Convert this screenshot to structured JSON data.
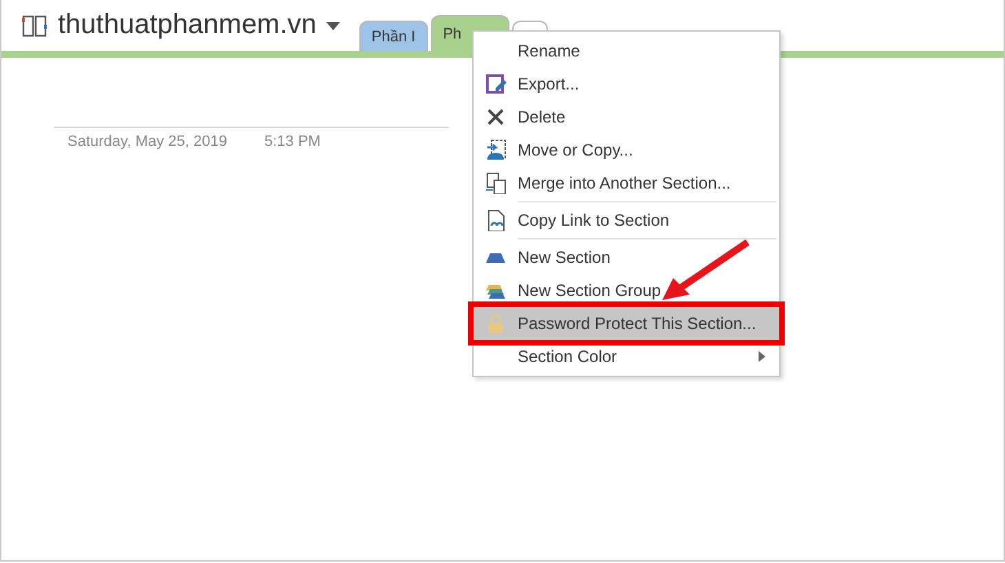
{
  "notebook": {
    "title": "thuthuatphanmem.vn"
  },
  "tabs": [
    {
      "label": "Phần I",
      "selected": false,
      "color": "#9dc3e6"
    },
    {
      "label": "Ph",
      "selected": true,
      "color": "#a9d18e"
    },
    {
      "selected": false,
      "color": "#ffffff"
    }
  ],
  "page": {
    "date": "Saturday, May 25, 2019",
    "time": "5:13 PM"
  },
  "context_menu": {
    "groups": [
      [
        {
          "label": "Rename",
          "kind": "plain",
          "highlighted": false,
          "submenu": false
        },
        {
          "label": "Export...",
          "kind": "export",
          "highlighted": false,
          "submenu": false
        },
        {
          "label": "Delete",
          "kind": "delete",
          "highlighted": false,
          "submenu": false
        },
        {
          "label": "Move or Copy...",
          "kind": "move",
          "highlighted": false,
          "submenu": false
        },
        {
          "label": "Merge into Another Section...",
          "kind": "merge",
          "highlighted": false,
          "submenu": false
        }
      ],
      [
        {
          "label": "Copy Link to Section",
          "kind": "link",
          "highlighted": false,
          "submenu": false
        }
      ],
      [
        {
          "label": "New Section",
          "kind": "section",
          "highlighted": false,
          "submenu": false
        },
        {
          "label": "New Section Group",
          "kind": "group",
          "highlighted": false,
          "submenu": false
        },
        {
          "label": "Password Protect This Section...",
          "kind": "lock",
          "highlighted": true,
          "submenu": false
        },
        {
          "label": "Section Color",
          "kind": "plain",
          "highlighted": false,
          "submenu": true
        }
      ]
    ]
  }
}
